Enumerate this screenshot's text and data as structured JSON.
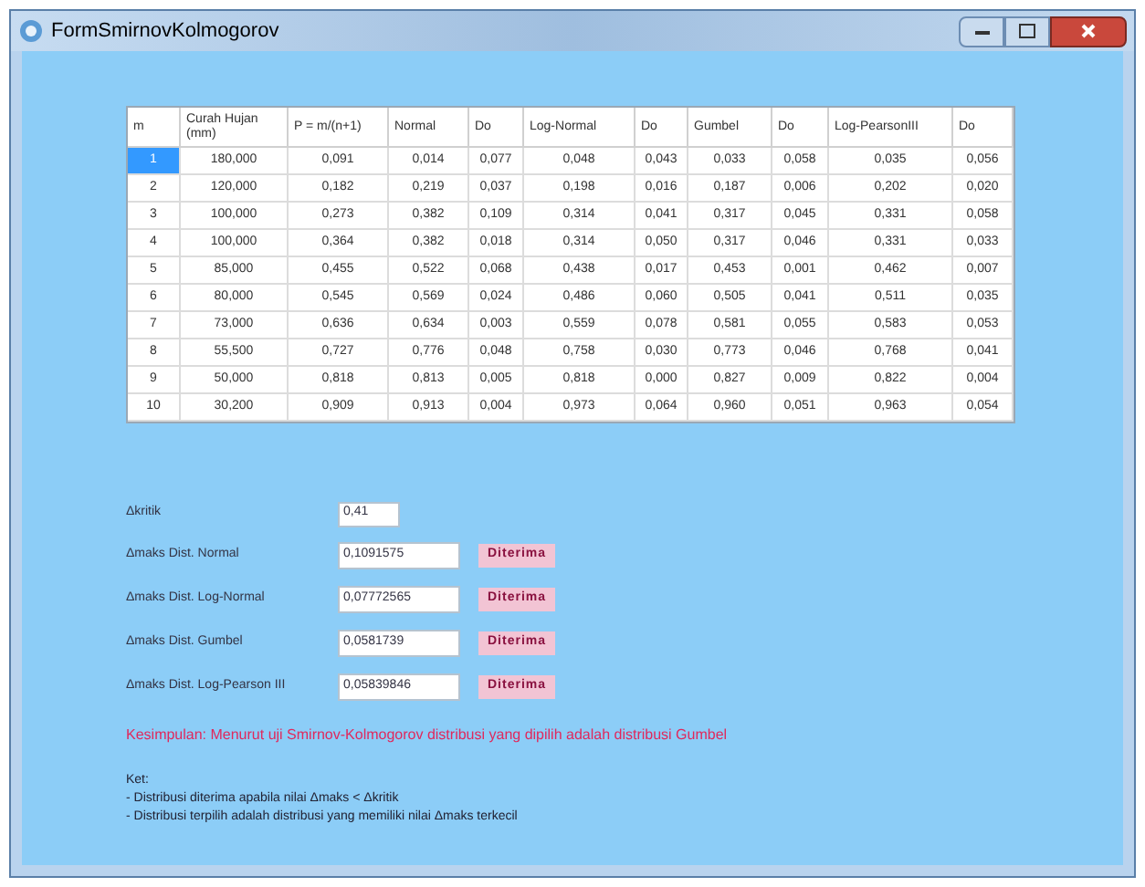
{
  "window": {
    "title": "FormSmirnovKolmogorov"
  },
  "table": {
    "columns": [
      "m",
      "Curah Hujan (mm)",
      "P = m/(n+1)",
      "Normal",
      "Do",
      "Log-Normal",
      "Do",
      "Gumbel",
      "Do",
      "Log-PearsonIII",
      "Do"
    ],
    "rows": [
      {
        "selected": true,
        "cells": [
          "1",
          "180,000",
          "0,091",
          "0,014",
          "0,077",
          "0,048",
          "0,043",
          "0,033",
          "0,058",
          "0,035",
          "0,056"
        ]
      },
      {
        "selected": false,
        "cells": [
          "2",
          "120,000",
          "0,182",
          "0,219",
          "0,037",
          "0,198",
          "0,016",
          "0,187",
          "0,006",
          "0,202",
          "0,020"
        ]
      },
      {
        "selected": false,
        "cells": [
          "3",
          "100,000",
          "0,273",
          "0,382",
          "0,109",
          "0,314",
          "0,041",
          "0,317",
          "0,045",
          "0,331",
          "0,058"
        ]
      },
      {
        "selected": false,
        "cells": [
          "4",
          "100,000",
          "0,364",
          "0,382",
          "0,018",
          "0,314",
          "0,050",
          "0,317",
          "0,046",
          "0,331",
          "0,033"
        ]
      },
      {
        "selected": false,
        "cells": [
          "5",
          "85,000",
          "0,455",
          "0,522",
          "0,068",
          "0,438",
          "0,017",
          "0,453",
          "0,001",
          "0,462",
          "0,007"
        ]
      },
      {
        "selected": false,
        "cells": [
          "6",
          "80,000",
          "0,545",
          "0,569",
          "0,024",
          "0,486",
          "0,060",
          "0,505",
          "0,041",
          "0,511",
          "0,035"
        ]
      },
      {
        "selected": false,
        "cells": [
          "7",
          "73,000",
          "0,636",
          "0,634",
          "0,003",
          "0,559",
          "0,078",
          "0,581",
          "0,055",
          "0,583",
          "0,053"
        ]
      },
      {
        "selected": false,
        "cells": [
          "8",
          "55,500",
          "0,727",
          "0,776",
          "0,048",
          "0,758",
          "0,030",
          "0,773",
          "0,046",
          "0,768",
          "0,041"
        ]
      },
      {
        "selected": false,
        "cells": [
          "9",
          "50,000",
          "0,818",
          "0,813",
          "0,005",
          "0,818",
          "0,000",
          "0,827",
          "0,009",
          "0,822",
          "0,004"
        ]
      },
      {
        "selected": false,
        "cells": [
          "10",
          "30,200",
          "0,909",
          "0,913",
          "0,004",
          "0,973",
          "0,064",
          "0,960",
          "0,051",
          "0,963",
          "0,054"
        ]
      }
    ]
  },
  "kritik": {
    "label": "Δkritik",
    "value": "0,41"
  },
  "results": [
    {
      "label": "Δmaks Dist. Normal",
      "value": "0,1091575",
      "status": "Diterima"
    },
    {
      "label": "Δmaks Dist. Log-Normal",
      "value": "0,07772565",
      "status": "Diterima"
    },
    {
      "label": "Δmaks Dist. Gumbel",
      "value": "0,0581739",
      "status": "Diterima"
    },
    {
      "label": "Δmaks Dist. Log-Pearson III",
      "value": "0,05839846",
      "status": "Diterima"
    }
  ],
  "conclusion": "Kesimpulan: Menurut uji Smirnov-Kolmogorov distribusi yang dipilih adalah distribusi Gumbel",
  "notes": {
    "title": "Ket:",
    "lines": [
      "- Distribusi diterima apabila nilai Δmaks < Δkritik",
      "- Distribusi terpilih adalah distribusi yang memiliki nilai Δmaks terkecil"
    ]
  }
}
